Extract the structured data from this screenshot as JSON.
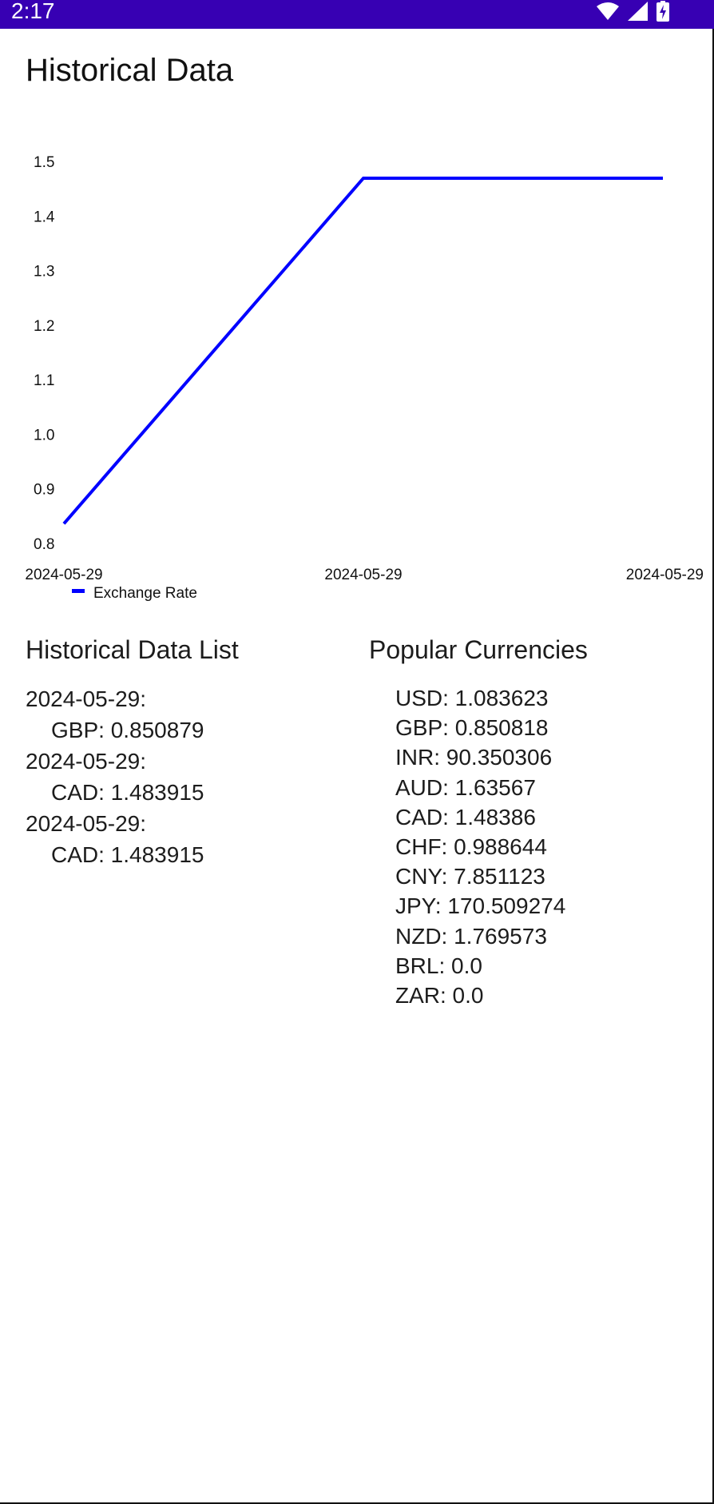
{
  "status_bar": {
    "time": "2:17",
    "icons": [
      "wifi-icon",
      "cell-signal-icon",
      "battery-charging-icon"
    ]
  },
  "page": {
    "title": "Historical Data"
  },
  "colors": {
    "status_bar": "#3700b3",
    "series": "#0000ff",
    "background": "#ffffff"
  },
  "chart_data": {
    "type": "line",
    "x": [
      "2024-05-29",
      "2024-05-29",
      "2024-05-29"
    ],
    "series": [
      {
        "name": "Exchange Rate",
        "values": [
          0.850879,
          1.483915,
          1.483915
        ]
      }
    ],
    "yticks": [
      "1.5",
      "1.4",
      "1.3",
      "1.2",
      "1.1",
      "1.0",
      "0.9",
      "0.8"
    ],
    "ylim": [
      0.8,
      1.5
    ],
    "grid": false,
    "legend_position": "bottom-left"
  },
  "historical": {
    "title": "Historical Data List",
    "entries": [
      {
        "date": "2024-05-29:",
        "rate": "GBP: 0.850879"
      },
      {
        "date": "2024-05-29:",
        "rate": "CAD: 1.483915"
      },
      {
        "date": "2024-05-29:",
        "rate": "CAD: 1.483915"
      }
    ]
  },
  "popular": {
    "title": "Popular Currencies",
    "items": [
      "USD: 1.083623",
      "GBP: 0.850818",
      "INR: 90.350306",
      "AUD: 1.63567",
      "CAD: 1.48386",
      "CHF: 0.988644",
      "CNY: 7.851123",
      "JPY: 170.509274",
      "NZD: 1.769573",
      "BRL: 0.0",
      "ZAR: 0.0"
    ]
  }
}
